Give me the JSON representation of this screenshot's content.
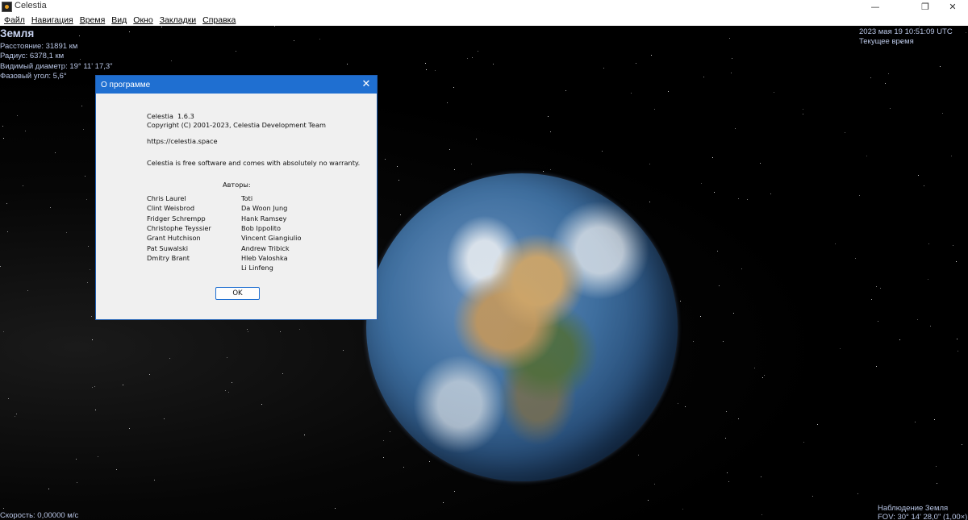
{
  "window": {
    "title": "Celestia",
    "controls": {
      "minimize": "—",
      "maximize": "❐",
      "close": "✕"
    }
  },
  "menu": [
    "Файл",
    "Навигация",
    "Время",
    "Вид",
    "Окно",
    "Закладки",
    "Справка"
  ],
  "hud": {
    "object_name": "Земля",
    "info": [
      "Расстояние: 31891 км",
      "Радиус: 6378,1 км",
      "Видимый диаметр: 19° 11' 17,3\"",
      "Фазовый угол: 5,6°"
    ],
    "datetime": "2023 мая 19 10:51:09 UTC",
    "time_mode": "Текущее время",
    "speed": "Скорость: 0,00000 м/с",
    "observe": "Наблюдение Земля",
    "fov": "FOV: 30° 14' 28,0\" (1,00×)"
  },
  "dialog": {
    "title": "О программе",
    "close_icon": "✕",
    "app_name": "Celestia",
    "version": "1.6.3",
    "copyright": "Copyright (C) 2001-2023, Celestia Development Team",
    "url": "https://celestia.space",
    "license": "Celestia is free software and comes with absolutely no warranty.",
    "authors_heading": "Авторы:",
    "authors_col1": [
      "Chris Laurel",
      "Clint Weisbrod",
      "Fridger Schrempp",
      "Christophe Teyssier",
      "Grant Hutchison",
      "Pat Suwalski",
      "Dmitry Brant"
    ],
    "authors_col2": [
      "Toti",
      "Da Woon Jung",
      "Hank Ramsey",
      "Bob Ippolito",
      "Vincent Giangiulio",
      "Andrew Tribick",
      "Hleb Valoshka",
      "Li Linfeng"
    ],
    "ok_label": "OK"
  }
}
